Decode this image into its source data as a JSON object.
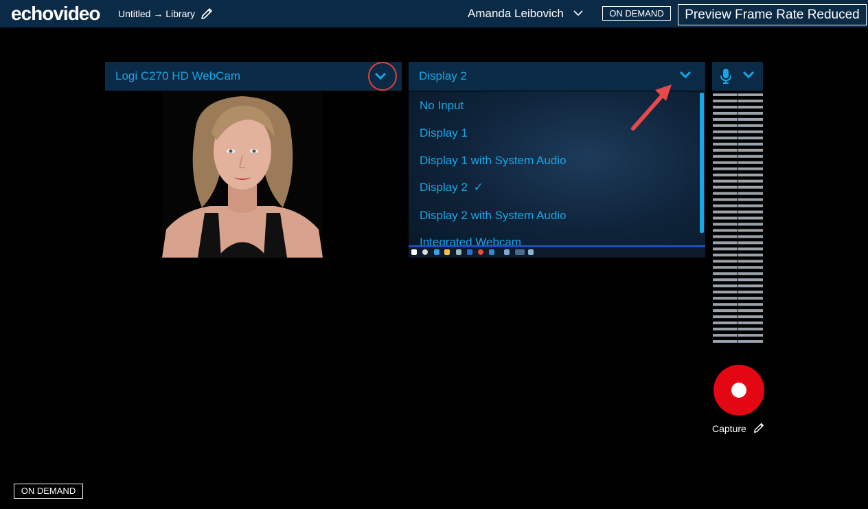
{
  "header": {
    "logo": "echovideo",
    "breadcrumb": "Untitled → Library",
    "user_name": "Amanda Leibovich",
    "mode_badge": "ON DEMAND",
    "preview_status": "Preview Frame Rate Reduced"
  },
  "camera_source": {
    "selected": "Logi C270 HD WebCam"
  },
  "display_source": {
    "selected": "Display 2",
    "options": [
      {
        "label": "No Input"
      },
      {
        "label": "Display 1"
      },
      {
        "label": "Display 1 with System Audio"
      },
      {
        "label": "Display 2",
        "check": "✓"
      },
      {
        "label": "Display 2 with System Audio"
      },
      {
        "label": "Integrated Webcam"
      }
    ]
  },
  "capture": {
    "label": "Capture"
  },
  "footer": {
    "mode_badge": "ON DEMAND"
  },
  "colors": {
    "accent": "#19a6e6",
    "bar_bg": "#0b2a45",
    "record": "#e30613",
    "highlight": "#e0413e"
  }
}
